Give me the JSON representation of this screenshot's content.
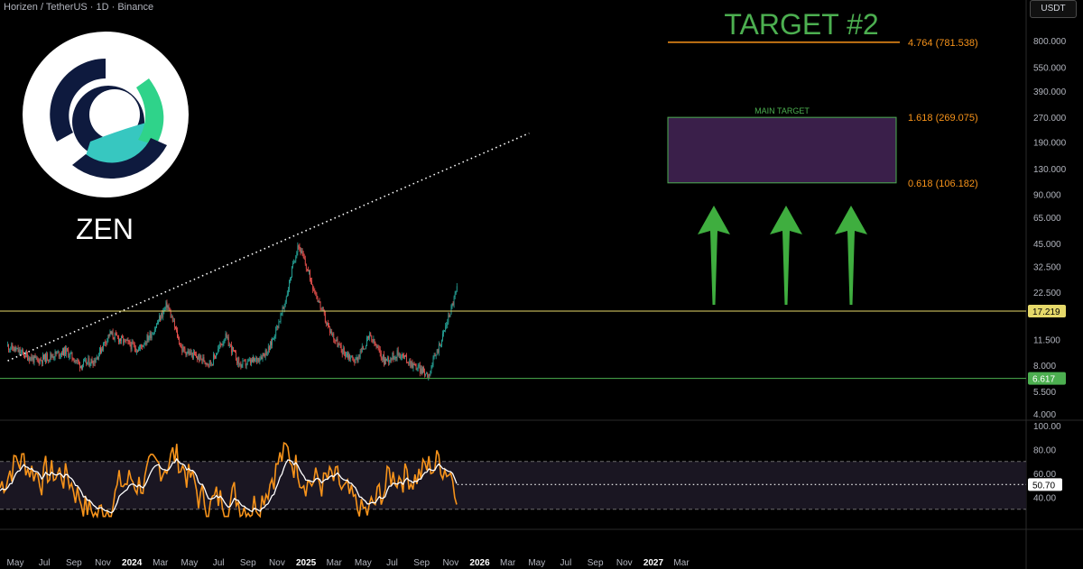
{
  "header": {
    "symbol_title": "Horizen / TetherUS · 1D · Binance",
    "currency": "USDT"
  },
  "logo": {
    "ticker": "ZEN",
    "icon": "horizen-logo-icon"
  },
  "colors": {
    "background": "#000000",
    "candle_up": "#26a69a",
    "candle_down": "#ef5350",
    "rsi_line": "#f7931a",
    "rsi_ma": "#ffffff",
    "resistance": "#e6d96a",
    "support": "#4caf50",
    "target_line": "#f7931a",
    "target_box_fill": "#3a1f4a",
    "target_box_border": "#4caf50",
    "arrow": "#3fae3f"
  },
  "chart_data": {
    "type": "candlestick",
    "y_scale": "log",
    "price_axis_ticks": [
      "800.000",
      "550.000",
      "390.000",
      "270.000",
      "190.000",
      "130.000",
      "90.000",
      "65.000",
      "45.000",
      "32.500",
      "22.500",
      "11.500",
      "8.000",
      "5.500",
      "4.000"
    ],
    "price_axis_values": [
      800,
      550,
      390,
      270,
      190,
      130,
      90,
      65,
      45,
      32.5,
      22.5,
      11.5,
      8.0,
      5.5,
      4.0
    ],
    "time_axis_ticks": [
      "May",
      "Jul",
      "Sep",
      "Nov",
      "2024",
      "Mar",
      "May",
      "Jul",
      "Sep",
      "Nov",
      "2025",
      "Mar",
      "May",
      "Jul",
      "Sep",
      "Nov",
      "2026",
      "Mar",
      "May",
      "Jul",
      "Sep",
      "Nov",
      "2027",
      "Mar"
    ],
    "bold_time_ticks": [
      "2024",
      "2025",
      "2026",
      "2027"
    ],
    "price_series": {
      "name": "ZENUSDT",
      "x": [
        "2023-04",
        "2023-06",
        "2023-08",
        "2023-09",
        "2023-10",
        "2023-11",
        "2024-01",
        "2024-02",
        "2024-03",
        "2024-04",
        "2024-05",
        "2024-06",
        "2024-07",
        "2024-08",
        "2024-09",
        "2024-10",
        "2024-11",
        "2024-12",
        "2025-01",
        "2025-02",
        "2025-03",
        "2025-04",
        "2025-05",
        "2025-06",
        "2025-07",
        "2025-08",
        "2025-09",
        "2025-10",
        "2025-11"
      ],
      "y": [
        10.5,
        8.5,
        9.8,
        8.0,
        8.6,
        12.5,
        10.0,
        13.0,
        19.0,
        10.0,
        9.0,
        8.2,
        12.0,
        8.0,
        8.5,
        10.0,
        18.0,
        45.0,
        25.0,
        14.0,
        10.0,
        8.5,
        12.0,
        8.5,
        9.5,
        8.0,
        7.0,
        12.0,
        24.0
      ]
    },
    "levels": [
      {
        "label": "17.219",
        "value": 17.219,
        "kind": "resistance"
      },
      {
        "label": "6.617",
        "value": 6.617,
        "kind": "support"
      }
    ],
    "fib_levels": [
      {
        "label": "4.764 (781.538)",
        "value": 781.538
      },
      {
        "label": "1.618 (269.075)",
        "value": 269.075
      },
      {
        "label": "0.618 (106.182)",
        "value": 106.182
      }
    ],
    "annotations": {
      "target_2": "TARGET #2",
      "main_target": "MAIN TARGET",
      "arrows": 3
    },
    "trendline": {
      "from": [
        "2023-04",
        8.5
      ],
      "to": [
        "2026-04",
        215
      ]
    },
    "rsi": {
      "ticks": [
        "100.00",
        "80.00",
        "60.00",
        "40.00"
      ],
      "tick_values": [
        100,
        80,
        60,
        40
      ],
      "bands": [
        70,
        30
      ],
      "current_label": "50.70",
      "current": 50.7
    }
  }
}
